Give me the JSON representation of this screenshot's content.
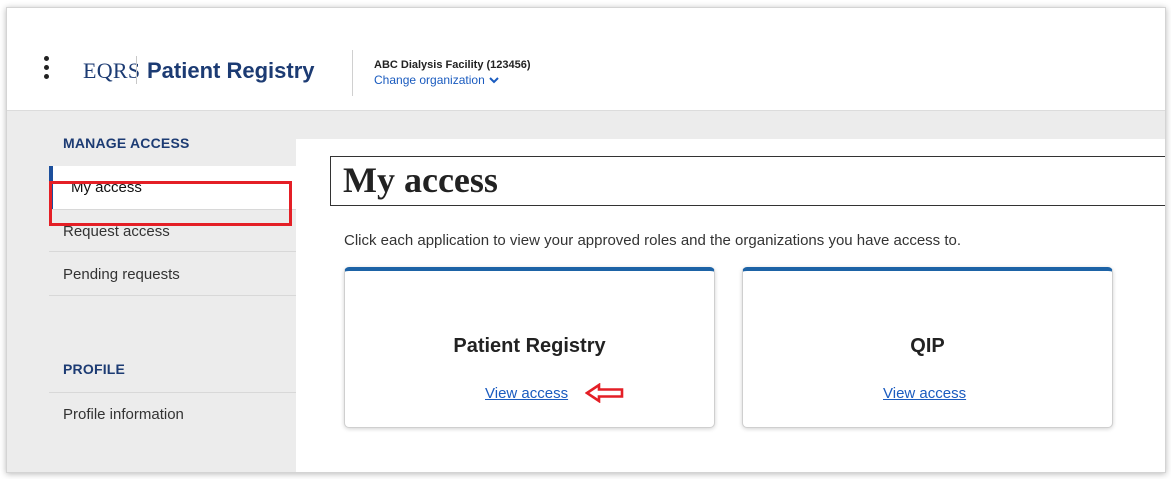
{
  "header": {
    "menu_icon": "kebab-menu-icon",
    "brand_short": "EQRS",
    "brand_app": "Patient Registry",
    "organization_name": "ABC Dialysis Facility (123456)",
    "change_organization": "Change organization",
    "change_org_icon": "chevron-down-icon"
  },
  "sidebar": {
    "manage_access_heading": "MANAGE ACCESS",
    "manage_items": [
      {
        "label": "My access",
        "active": true
      },
      {
        "label": "Request access",
        "active": false
      },
      {
        "label": "Pending requests",
        "active": false
      }
    ],
    "profile_heading": "PROFILE",
    "profile_items": [
      {
        "label": "Profile information",
        "active": false
      }
    ]
  },
  "main": {
    "title": "My access",
    "intro": "Click each application to view your approved roles and the organizations you have access to.",
    "cards": [
      {
        "title": "Patient Registry",
        "link": "View access"
      },
      {
        "title": "QIP",
        "link": "View access"
      }
    ]
  },
  "annotations": {
    "highlight_color": "#e41f26",
    "arrow_icon": "left-arrow-icon"
  },
  "colors": {
    "brand": "#1c3b73",
    "link": "#1a5bbf",
    "card_accent": "#1d63a6"
  }
}
